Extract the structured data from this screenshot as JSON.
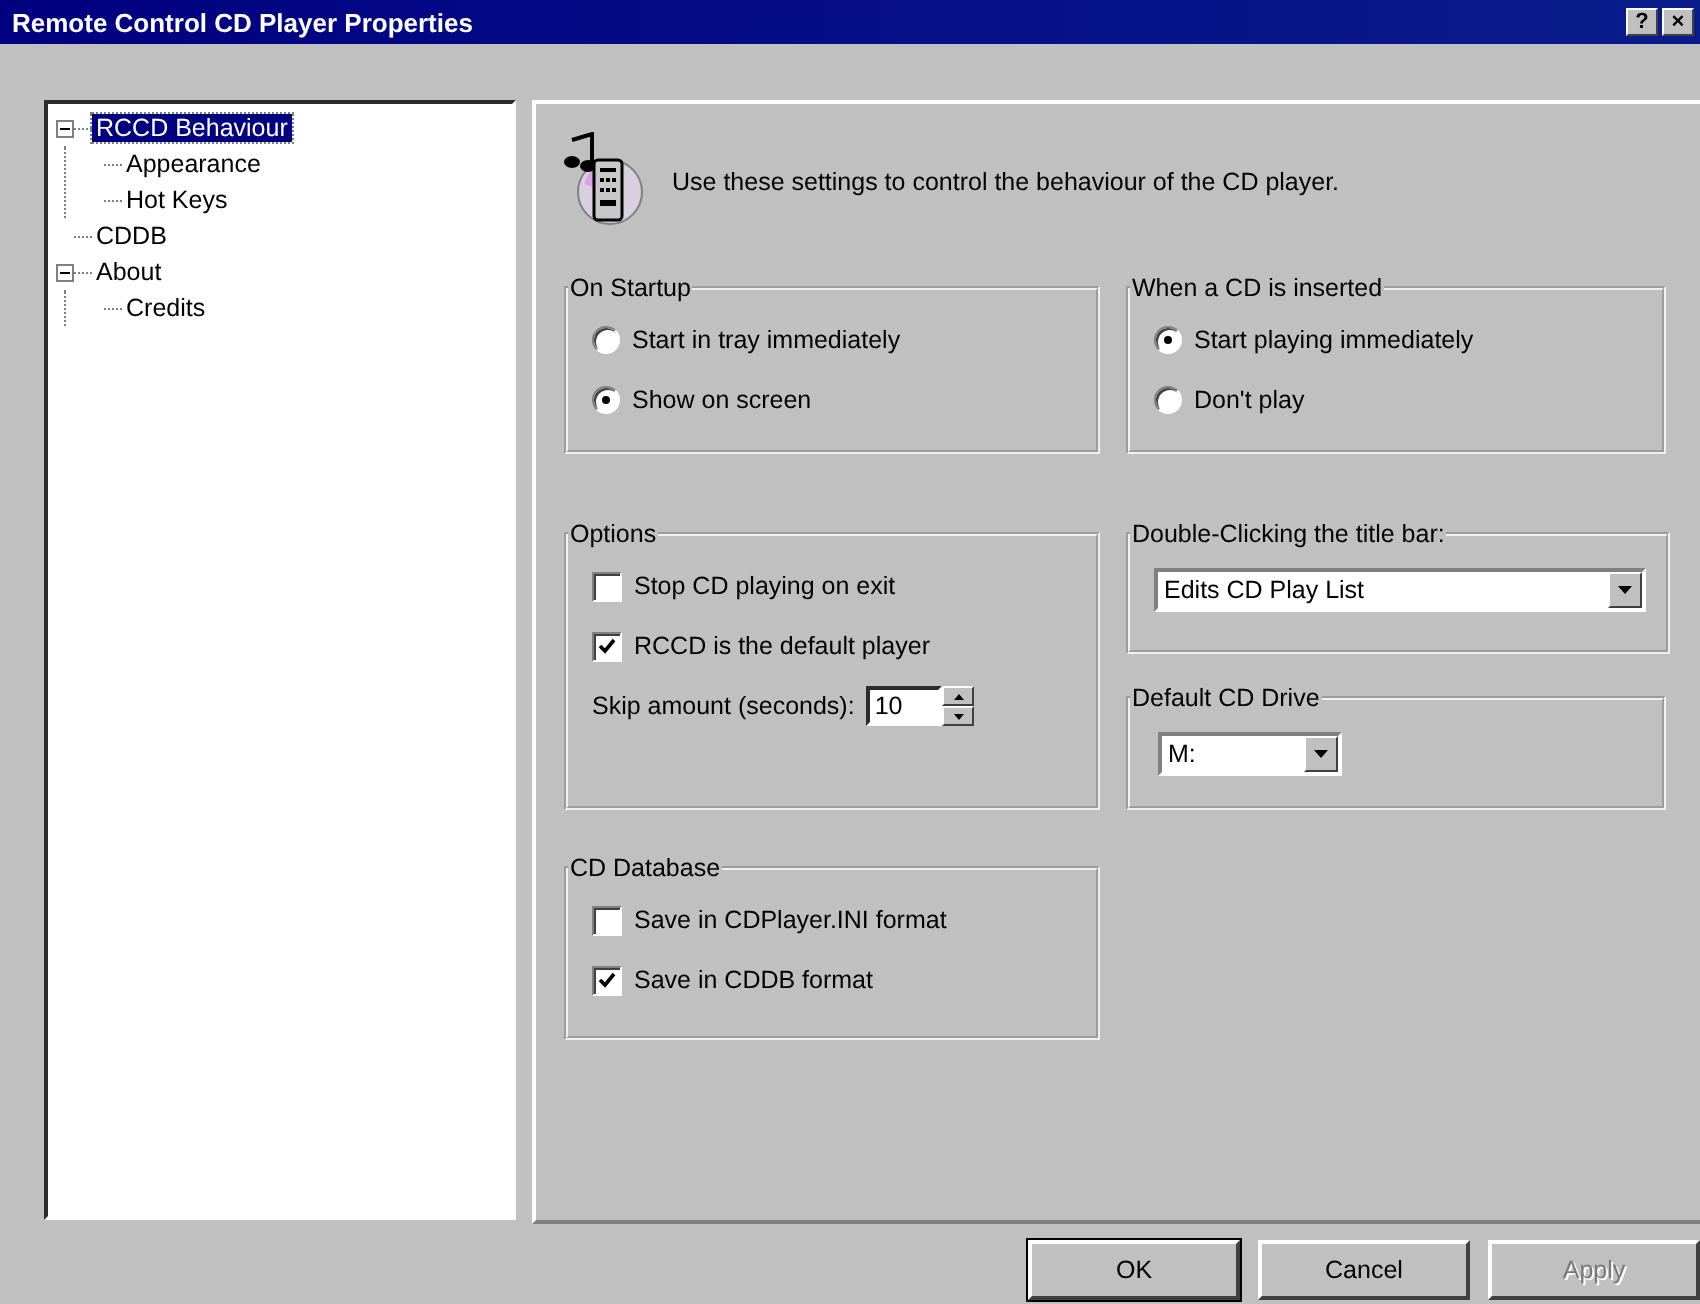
{
  "window": {
    "title": "Remote Control CD Player Properties",
    "help": "?",
    "close": "×"
  },
  "tree": [
    {
      "label": "RCCD Behaviour",
      "selected": true,
      "expanded": true,
      "children": [
        {
          "label": "Appearance",
          "selected": false
        },
        {
          "label": "Hot Keys",
          "selected": false
        }
      ]
    },
    {
      "label": "CDDB",
      "selected": false
    },
    {
      "label": "About",
      "selected": false,
      "expanded": true,
      "children": [
        {
          "label": "Credits",
          "selected": false
        }
      ]
    }
  ],
  "header": "Use these settings to control the behaviour of the CD player.",
  "left_column": [
    {
      "title": "On Startup",
      "items": [
        {
          "kind": "radio",
          "label": "Start in tray immediately",
          "selected": false
        },
        {
          "kind": "radio",
          "label": "Show on screen",
          "selected": true
        }
      ]
    },
    {
      "title": "Options",
      "items": [
        {
          "kind": "checkbox",
          "label": "Stop CD playing on exit",
          "checked": false
        },
        {
          "kind": "checkbox",
          "label": "RCCD is the default player",
          "checked": true
        },
        {
          "kind": "spinner",
          "label": "Skip amount (seconds):",
          "value": "10"
        }
      ]
    },
    {
      "title": "CD Database",
      "items": [
        {
          "kind": "checkbox",
          "label": "Save in CDPlayer.INI format",
          "checked": false
        },
        {
          "kind": "checkbox",
          "label": "Save in CDDB format",
          "checked": true
        }
      ]
    }
  ],
  "right_column": [
    {
      "title": "When a CD is inserted",
      "items": [
        {
          "kind": "radio",
          "label": "Start playing immediately",
          "selected": true
        },
        {
          "kind": "radio",
          "label": "Don't play",
          "selected": false
        }
      ]
    },
    {
      "title": "Double-Clicking the title bar:",
      "items": [
        {
          "kind": "combo",
          "value": "Edits CD Play List"
        }
      ]
    },
    {
      "title": "Default CD Drive",
      "items": [
        {
          "kind": "combo",
          "value": "M:"
        }
      ]
    }
  ],
  "buttons": [
    {
      "label": "OK",
      "disabled": false
    },
    {
      "label": "Cancel",
      "disabled": false
    },
    {
      "label": "Apply",
      "disabled": true
    }
  ]
}
